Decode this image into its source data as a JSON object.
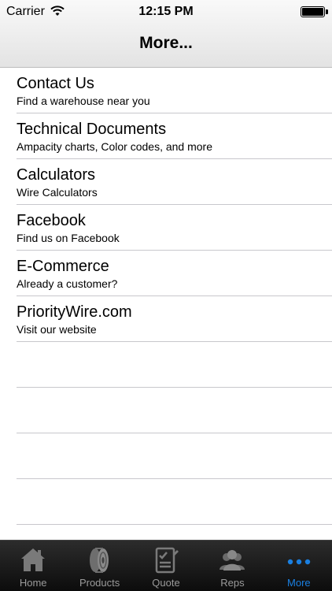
{
  "status_bar": {
    "carrier": "Carrier",
    "time": "12:15 PM"
  },
  "nav": {
    "title": "More..."
  },
  "menu_items": [
    {
      "title": "Contact Us",
      "subtitle": "Find a warehouse near you"
    },
    {
      "title": "Technical Documents",
      "subtitle": "Ampacity charts, Color codes, and more"
    },
    {
      "title": "Calculators",
      "subtitle": "Wire Calculators"
    },
    {
      "title": "Facebook",
      "subtitle": "Find us on Facebook"
    },
    {
      "title": "E-Commerce",
      "subtitle": "Already a customer?"
    },
    {
      "title": "PriorityWire.com",
      "subtitle": "Visit our website"
    }
  ],
  "tabbar": {
    "items": [
      {
        "label": "Home",
        "icon": "home-icon"
      },
      {
        "label": "Products",
        "icon": "wire-spool-icon"
      },
      {
        "label": "Quote",
        "icon": "quote-form-icon"
      },
      {
        "label": "Reps",
        "icon": "people-icon"
      },
      {
        "label": "More",
        "icon": "more-dots-icon"
      }
    ],
    "active_color": "#1a7fe0",
    "inactive_color": "#9a9a9a"
  }
}
